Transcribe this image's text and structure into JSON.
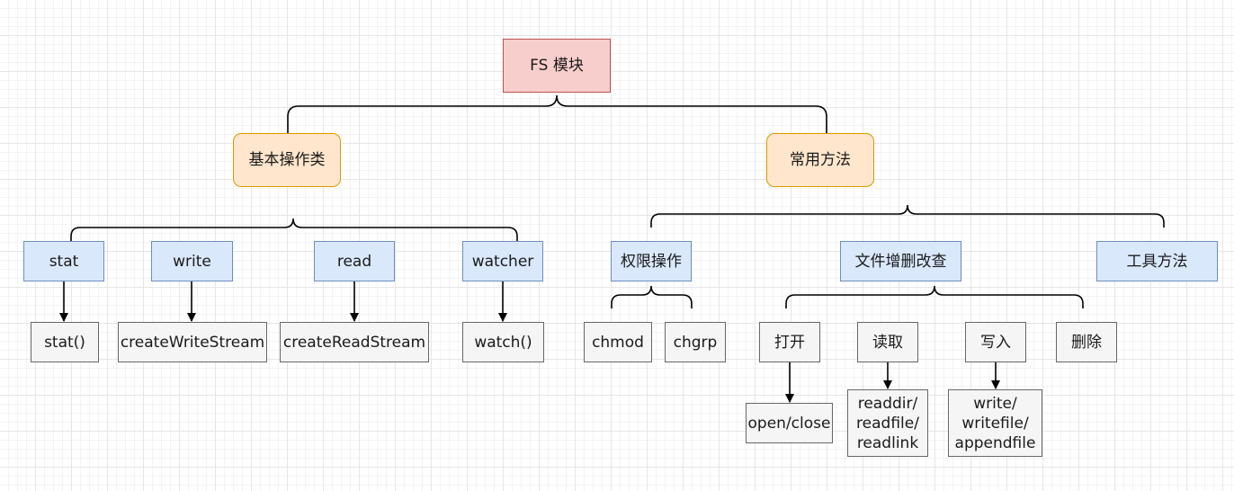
{
  "root": {
    "label": "FS 模块"
  },
  "categories": [
    {
      "label": "基本操作类"
    },
    {
      "label": "常用方法"
    }
  ],
  "basic_ops": [
    {
      "label": "stat",
      "method": "stat()"
    },
    {
      "label": "write",
      "method": "createWriteStream"
    },
    {
      "label": "read",
      "method": "createReadStream"
    },
    {
      "label": "watcher",
      "method": "watch()"
    }
  ],
  "common_methods": {
    "permission": {
      "label": "权限操作",
      "children": [
        "chmod",
        "chgrp"
      ]
    },
    "file_crud": {
      "label": "文件增删改查",
      "children": [
        {
          "label": "打开",
          "detail": "open/close"
        },
        {
          "label": "读取",
          "detail": "readdir/\nreadfile/\nreadlink"
        },
        {
          "label": "写入",
          "detail": "write/\nwritefile/\nappendfile"
        },
        {
          "label": "删除"
        }
      ]
    },
    "tools": {
      "label": "工具方法"
    }
  },
  "colors": {
    "root_fill": "#f8cecc",
    "root_stroke": "#b85450",
    "category_fill": "#ffe6cc",
    "category_stroke": "#d79b00",
    "blue_fill": "#dae8fc",
    "blue_stroke": "#6c8ebf",
    "gray_fill": "#f5f5f5",
    "gray_stroke": "#666666"
  }
}
